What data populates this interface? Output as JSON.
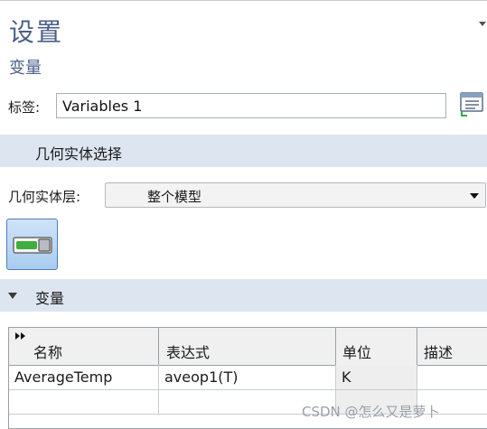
{
  "panel": {
    "title": "设置",
    "subtitle": "变量"
  },
  "label_field": {
    "label": "标签:",
    "value": "Variables 1",
    "button_icon": "document-list-icon"
  },
  "geometry_section": {
    "title": "几何实体选择"
  },
  "geometry_level": {
    "label": "几何实体层:",
    "selected": "整个模型"
  },
  "variables_section": {
    "title": "变量"
  },
  "table": {
    "headers": [
      "名称",
      "表达式",
      "单位",
      "描述"
    ],
    "rows": [
      [
        "AverageTemp",
        "aveop1(T)",
        "K",
        ""
      ],
      [
        "",
        "",
        "",
        ""
      ]
    ]
  },
  "watermark": "CSDN @怎么又是萝卜",
  "colors": {
    "section_bg": "#dde5f0",
    "title": "#4a5f8a",
    "toggle_green": "#3fae3f"
  }
}
